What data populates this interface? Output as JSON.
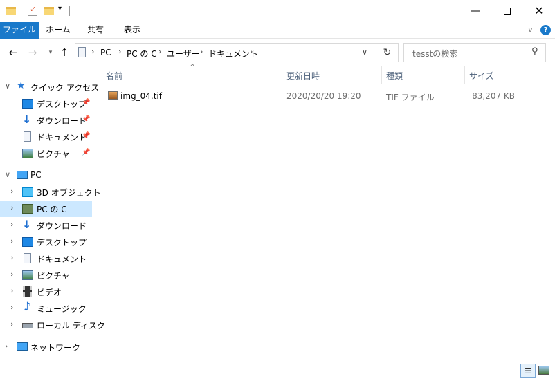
{
  "ribbon": {
    "tabs": [
      "ファイル",
      "ホーム",
      "共有",
      "表示"
    ]
  },
  "address": {
    "crumbs": [
      "PC",
      "PC の C",
      "ユーザー",
      "ドキュメント"
    ],
    "search_placeholder": "tesstの検索"
  },
  "nav": {
    "quick_access": "クイック アクセス",
    "qa_items": [
      "デスクトップ",
      "ダウンロード",
      "ドキュメント",
      "ピクチャ"
    ],
    "pc": "PC",
    "pc_items": [
      "3D オブジェクト",
      "PC の C",
      "ダウンロード",
      "デスクトップ",
      "ドキュメント",
      "ピクチャ",
      "ビデオ",
      "ミュージック",
      "ローカル ディスク"
    ],
    "network": "ネットワーク"
  },
  "columns": {
    "name": "名前",
    "date": "更新日時",
    "type": "種類",
    "size": "サイズ"
  },
  "files": [
    {
      "name": "img_04.tif",
      "date": "2020/20/20 19:20",
      "type": "TIF ファイル",
      "size": "83,207 KB"
    }
  ],
  "colors": {
    "accent": "#1979ca",
    "selected": "#cce8ff"
  }
}
